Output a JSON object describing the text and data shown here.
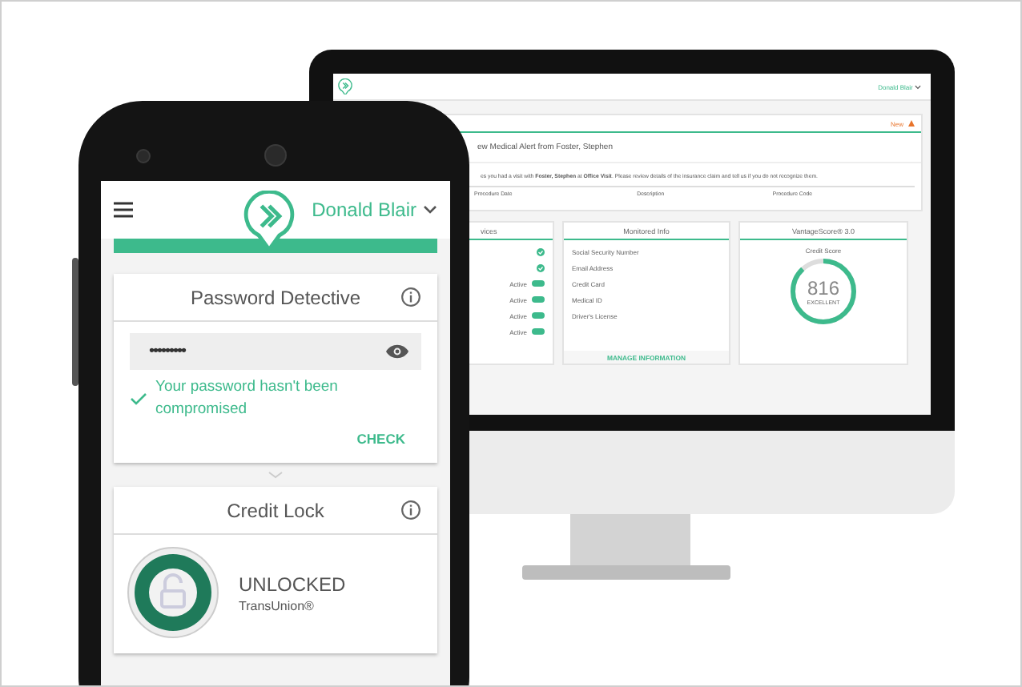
{
  "monitor": {
    "user": "Donald Blair",
    "notifications": {
      "new_label": "New",
      "alert_title": "ew Medical Alert from Foster, Stephen",
      "message": "es you had a visit with **Foster, Stephen** at **Office Visit**. Please review details of the insurance claim and tell us if you do not recognize them.",
      "columns": [
        "Procedure Date",
        "Description",
        "Procedure Code"
      ]
    },
    "services": {
      "title": "vices",
      "rows": [
        {
          "kind": "check"
        },
        {
          "kind": "check"
        },
        {
          "kind": "toggle",
          "label": "Active",
          "on": true
        },
        {
          "kind": "toggle",
          "label": "Active",
          "on": true
        },
        {
          "kind": "toggle",
          "label": "Active",
          "on": true
        },
        {
          "kind": "toggle",
          "label": "Active",
          "on": true
        }
      ]
    },
    "monitored_info": {
      "title": "Monitored Info",
      "rows": [
        "Social Security Number",
        "Email Address",
        "Credit Card",
        "Medical ID",
        "Driver's License"
      ],
      "action": "MANAGE INFORMATION"
    },
    "vantage": {
      "title": "VantageScore® 3.0",
      "caption": "Credit Score",
      "score": "816",
      "rating": "EXCELLENT",
      "level": 0.88
    }
  },
  "phone": {
    "user": "Donald Blair",
    "password_card": {
      "title": "Password Detective",
      "password": "•••••••••",
      "message": "Your password hasn't been compromised",
      "action": "CHECK"
    },
    "credit_lock": {
      "title": "Credit Lock",
      "status": "UNLOCKED",
      "bureau": "TransUnion®"
    }
  }
}
